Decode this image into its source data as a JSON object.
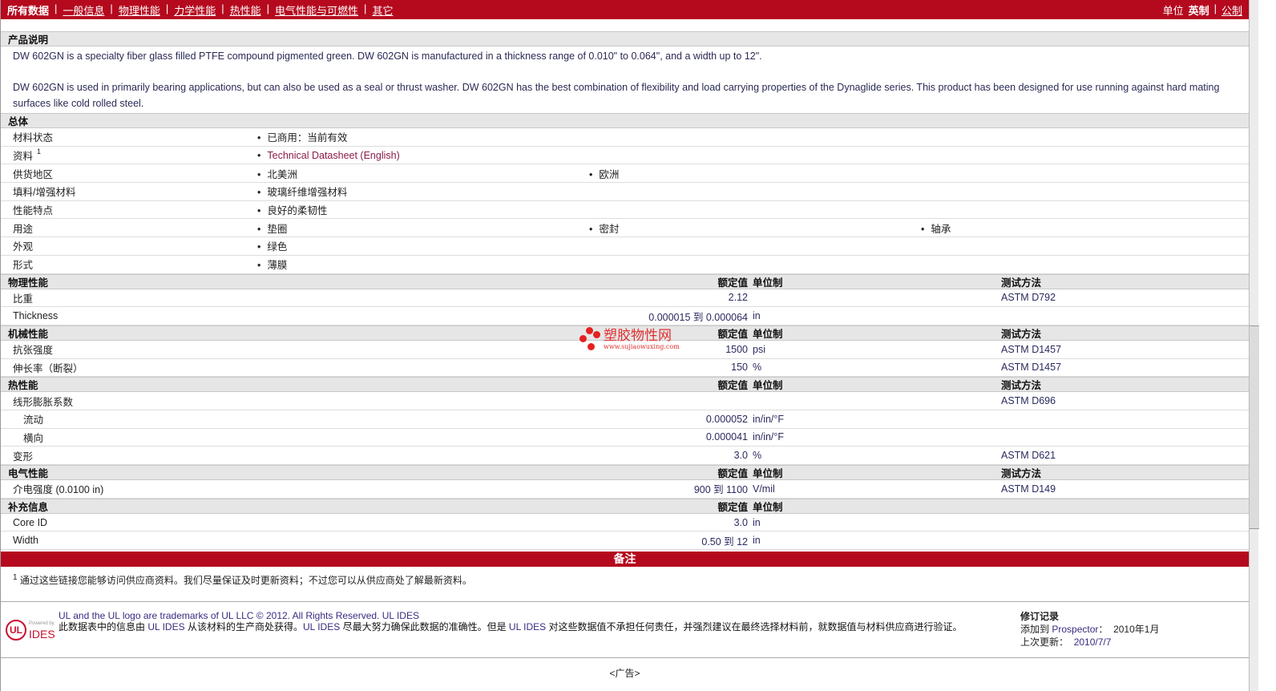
{
  "nav": {
    "all": "所有数据",
    "items": [
      "一般信息",
      "物理性能",
      "力学性能",
      "热性能",
      "电气性能与可燃性",
      "其它"
    ],
    "units_label": "单位",
    "english": "英制",
    "metric": "公制"
  },
  "desc": {
    "title": "产品说明",
    "p1": "DW 602GN is a specialty fiber glass filled PTFE compound pigmented green. DW 602GN is manufactured in a thickness range of 0.010\" to 0.064\", and a width up to 12\".",
    "p2": "DW 602GN is used in primarily bearing applications, but can also be used as a seal or thrust washer. DW 602GN has the best combination of flexibility and load carrying properties of the Dynaglide series. This product has been designed for use running against hard mating surfaces like cold rolled steel."
  },
  "general": {
    "title": "总体",
    "rows": [
      {
        "label": "材料状态",
        "items": [
          "已商用：当前有效"
        ]
      },
      {
        "label": "资料",
        "sup": "1",
        "items": [
          "Technical Datasheet (English)"
        ],
        "link": true
      },
      {
        "label": "供货地区",
        "items": [
          "北美洲",
          "欧洲"
        ]
      },
      {
        "label": "填料/增强材料",
        "items": [
          "玻璃纤维增强材料"
        ]
      },
      {
        "label": "性能特点",
        "items": [
          "良好的柔韧性"
        ]
      },
      {
        "label": "用途",
        "items": [
          "垫圈",
          "密封",
          "轴承"
        ]
      },
      {
        "label": "外观",
        "items": [
          "绿色"
        ]
      },
      {
        "label": "形式",
        "items": [
          "薄膜"
        ]
      }
    ]
  },
  "headers": {
    "nominal": "额定值",
    "unit": "单位制",
    "test": "测试方法"
  },
  "sections": [
    {
      "title": "物理性能",
      "test": true,
      "rows": [
        {
          "label": "比重",
          "value": "2.12",
          "unit": "",
          "test": "ASTM D792"
        },
        {
          "label": "Thickness",
          "value": "0.000015 到  0.000064",
          "unit": "in",
          "test": ""
        }
      ]
    },
    {
      "title": "机械性能",
      "test": true,
      "rows": [
        {
          "label": "抗张强度",
          "value": "1500",
          "unit": "psi",
          "test": "ASTM D1457"
        },
        {
          "label": "伸长率（断裂）",
          "value": "150",
          "unit": "%",
          "test": "ASTM D1457"
        }
      ]
    },
    {
      "title": "热性能",
      "test": true,
      "rows": [
        {
          "label": "线形膨胀系数",
          "value": "",
          "unit": "",
          "test": "ASTM D696"
        },
        {
          "label": "流动",
          "sub": true,
          "value": "0.000052",
          "unit": "in/in/°F",
          "test": ""
        },
        {
          "label": "横向",
          "sub": true,
          "value": "0.000041",
          "unit": "in/in/°F",
          "test": ""
        },
        {
          "label": "变形",
          "value": "3.0",
          "unit": "%",
          "test": "ASTM D621"
        }
      ]
    },
    {
      "title": "电气性能",
      "test": true,
      "rows": [
        {
          "label": "介电强度 (0.0100 in)",
          "value": "900 到  1100",
          "unit": "V/mil",
          "test": "ASTM D149"
        }
      ]
    },
    {
      "title": "补充信息",
      "test": false,
      "rows": [
        {
          "label": "Core ID",
          "value": "3.0",
          "unit": "in",
          "test": ""
        },
        {
          "label": "Width",
          "value": "0.50 到  12",
          "unit": "in",
          "test": ""
        }
      ]
    }
  ],
  "notes": {
    "title": "备注",
    "sup": "1",
    "text": "通过这些链接您能够访问供应商资料。我们尽量保证及时更新资料；不过您可以从供应商处了解最新资料。"
  },
  "footer": {
    "powered": "Powered by",
    "ides": "IDES",
    "ul": "UL",
    "line1": "UL and the UL logo are trademarks of UL LLC © 2012. All Rights Reserved.",
    "ul_ides": "UL IDES",
    "line2a": "此数据表中的信息由",
    "line2b": "从该材料的生产商处获得。",
    "line2c": "尽最大努力确保此数据的准确性。但是",
    "line2d": "对这些数据值不承担任何责任，并强烈建议在最终选择材料前，就数据值与材料供应商进行验证。",
    "rev_title": "修订记录",
    "added_label": "添加到",
    "prospector": "Prospector",
    "added_sep": "：",
    "added_date": "2010年1月",
    "updated_label": "上次更新：",
    "updated_date": "2010/7/7"
  },
  "ad": "<广告>",
  "watermark": {
    "cn": "塑胶物性网",
    "url": "www.sujiaowuxing.com"
  }
}
